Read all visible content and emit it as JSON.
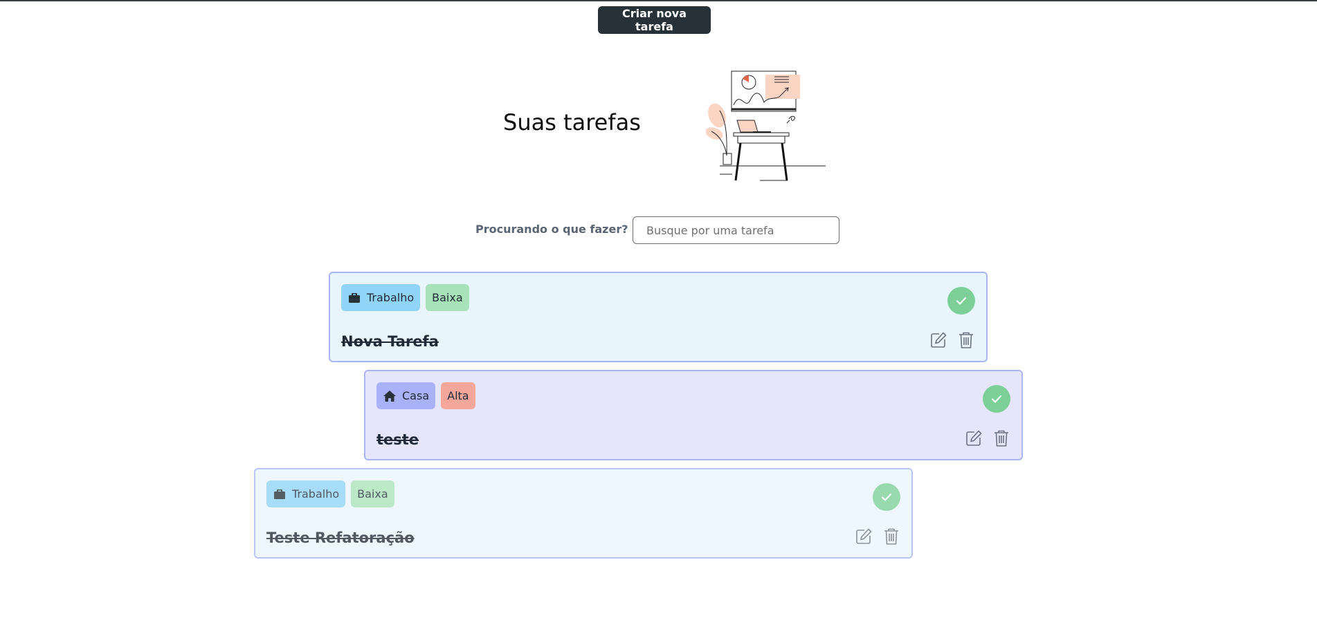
{
  "header": {
    "create_button_label": "Criar nova tarefa"
  },
  "page": {
    "title": "Suas tarefas",
    "illustration": "person-at-desk-with-chart-illustration"
  },
  "search": {
    "label": "Procurando o que fazer?",
    "placeholder": "Busque por uma tarefa",
    "value": ""
  },
  "tasks": [
    {
      "category": "Trabalho",
      "category_icon": "briefcase-icon",
      "priority": "Baixa",
      "title": "Nova Tarefa",
      "completed": true
    },
    {
      "category": "Casa",
      "category_icon": "house-icon",
      "priority": "Alta",
      "title": "teste",
      "completed": true
    },
    {
      "category": "Trabalho",
      "category_icon": "briefcase-icon",
      "priority": "Baixa",
      "title": "Teste Refatoração",
      "completed": true
    }
  ],
  "colors": {
    "primary_button": "#263238",
    "work_card_bg": "#e8f5fd",
    "home_card_bg": "#e6e6fb",
    "card_border": "#a9b4f5",
    "tag_work": "#90d4f8",
    "tag_home": "#aab2f7",
    "tag_low": "#a8e2b8",
    "tag_high": "#f4a69a",
    "done_green": "#7ccf97"
  }
}
